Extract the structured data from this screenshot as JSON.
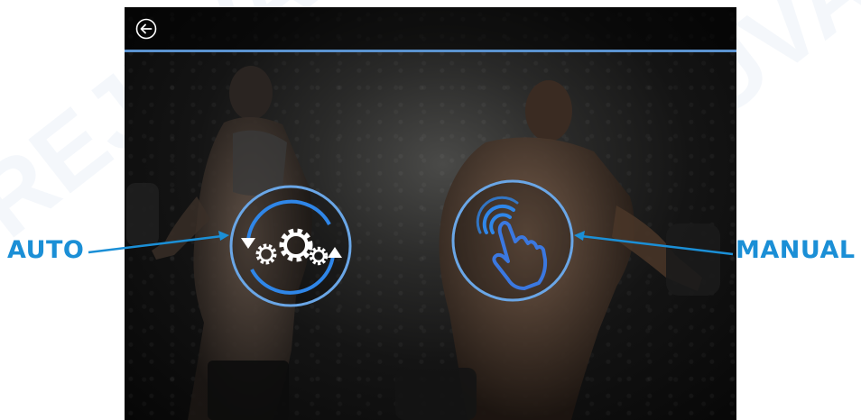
{
  "watermark": "REJUVA",
  "header": {
    "back_icon": "back-arrow-icon"
  },
  "modes": {
    "auto": {
      "label": "AUTO",
      "icon": "auto-gears-cycle-icon"
    },
    "manual": {
      "label": "MANUAL",
      "icon": "touch-hand-icon"
    }
  },
  "colors": {
    "accent": "#1b8fd6",
    "header_line": "#5b93d0",
    "button_ring": "#6aa6e6",
    "background": "#111111"
  }
}
